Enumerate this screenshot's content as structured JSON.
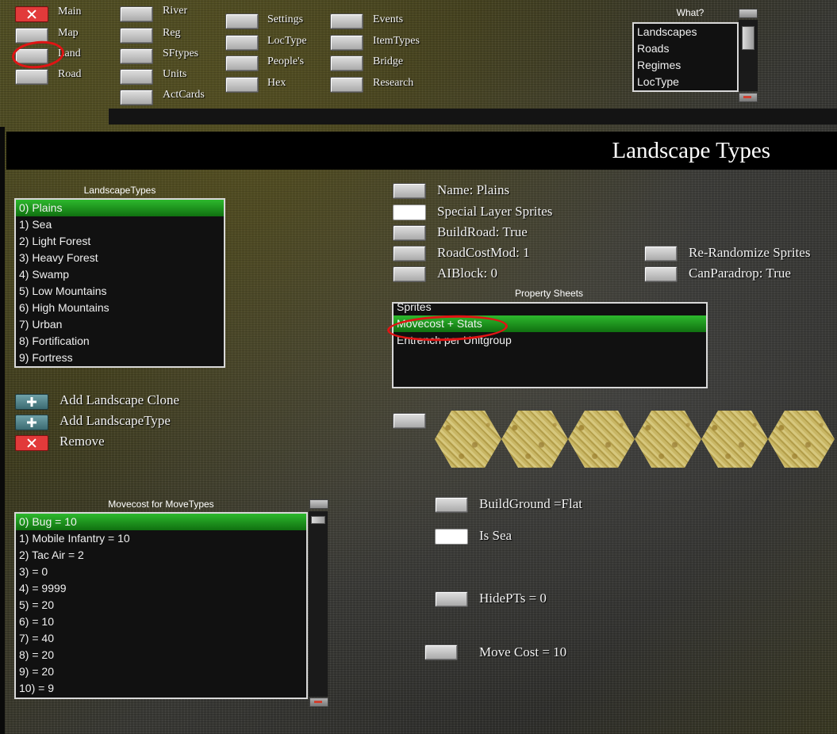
{
  "top_menu": {
    "col1": [
      "Main",
      "Map",
      "Land",
      "Road"
    ],
    "col2": [
      "River",
      "Reg",
      "SFtypes",
      "Units",
      "ActCards"
    ],
    "col3": [
      "Settings",
      "LocType",
      "People's",
      "Hex"
    ],
    "col4": [
      "Events",
      "ItemTypes",
      "Bridge",
      "Research"
    ]
  },
  "what": {
    "caption": "What?",
    "items": [
      "Landscapes",
      "Roads",
      "Regimes",
      "LocType"
    ]
  },
  "page_title": "Landscape Types",
  "landscape_list": {
    "caption": "LandscapeTypes",
    "items": [
      "0) Plains",
      "1) Sea",
      "2) Light Forest",
      "3) Heavy Forest",
      "4) Swamp",
      "5) Low Mountains",
      "6) High Mountains",
      "7) Urban",
      "8) Fortification",
      "9) Fortress"
    ],
    "selected": 0
  },
  "actions": {
    "add_clone": "Add Landscape Clone",
    "add_type": "Add LandscapeType",
    "remove": "Remove"
  },
  "properties": {
    "name": "Name: Plains",
    "special_layer": "Special Layer Sprites",
    "build_road": "BuildRoad: True",
    "road_cost": "RoadCostMod:  1",
    "ai_block": "AIBlock:  0",
    "rerandomize": "Re-Randomize Sprites",
    "can_paradrop": "CanParadrop: True"
  },
  "property_sheets": {
    "caption": "Property Sheets",
    "items": [
      "Sprites",
      "Movecost + Stats",
      "Entrench per Unitgroup"
    ],
    "selected": 1
  },
  "movecost": {
    "caption": "Movecost for MoveTypes",
    "items": [
      "0) Bug =  10",
      "1) Mobile Infantry =  10",
      "2) Tac Air =  2",
      "3)  =  0",
      "4)  =  9999",
      "5)  =  20",
      "6)  =  10",
      "7)  =  40",
      "8)  =  20",
      "9)  =  20",
      "10)  =  9"
    ],
    "selected": 0
  },
  "stats": {
    "build_ground": "BuildGround =Flat",
    "is_sea": "Is Sea",
    "hide_pts": "HidePTs = 0",
    "move_cost": "Move Cost =  10"
  },
  "colors": {
    "selection": "#1f9a1f",
    "annotation": "#e01414"
  }
}
